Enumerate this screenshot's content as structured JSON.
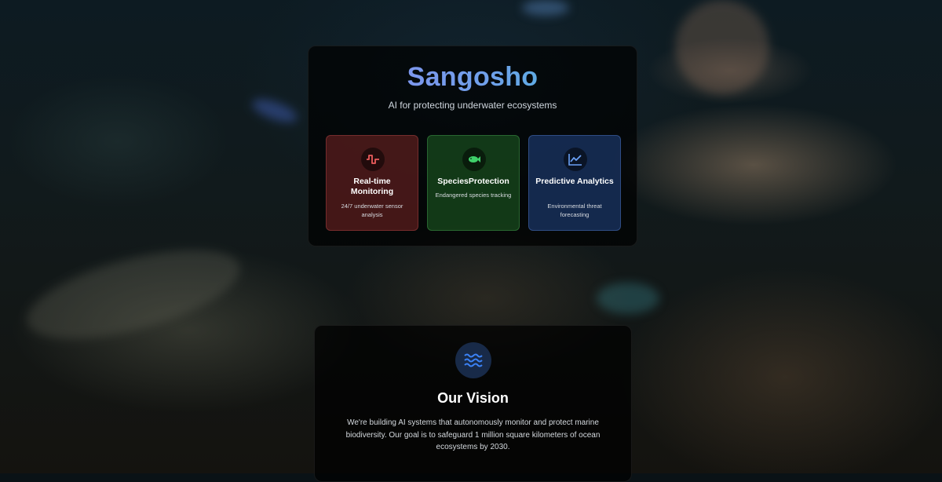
{
  "hero": {
    "title": "Sangosho",
    "subtitle": "AI for protecting underwater ecosystems"
  },
  "features": [
    {
      "name": "Real-time Monitoring",
      "description": "24/7 underwater sensor analysis",
      "icon": "waveform-icon",
      "accent": "#e05a5a"
    },
    {
      "name": "SpeciesProtection",
      "description": "Endangered species tracking",
      "icon": "fish-icon",
      "accent": "#3fd06a"
    },
    {
      "name": "Predictive Analytics",
      "description": "Environmental threat forecasting",
      "icon": "trend-chart-icon",
      "accent": "#5d93f0"
    }
  ],
  "vision": {
    "icon": "waves-icon",
    "title": "Our Vision",
    "text": "We're building AI systems that autonomously monitor and protect marine biodiversity. Our goal is to safeguard 1 million square kilometers of ocean ecosystems by 2030.",
    "accent": "#3b82f6"
  }
}
